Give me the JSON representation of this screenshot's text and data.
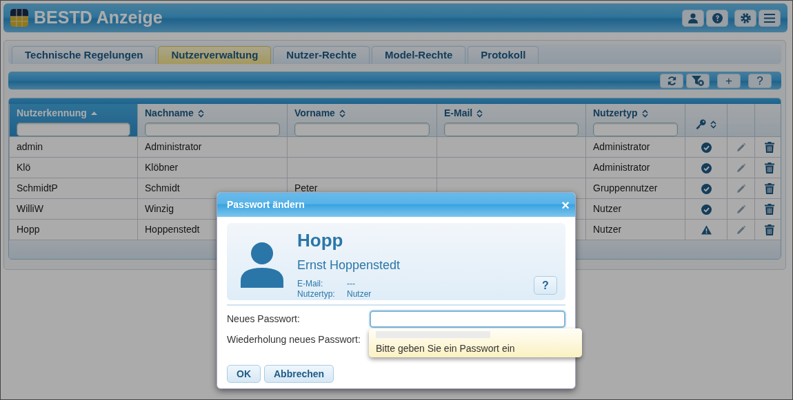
{
  "app": {
    "title": "BESTD Anzeige"
  },
  "tabs": [
    {
      "label": "Technische Regelungen",
      "selected": false
    },
    {
      "label": "Nutzerverwaltung",
      "selected": true
    },
    {
      "label": "Nutzer-Rechte",
      "selected": false
    },
    {
      "label": "Model-Rechte",
      "selected": false
    },
    {
      "label": "Protokoll",
      "selected": false
    }
  ],
  "toolbar": {
    "add_label": "+",
    "help_label": "?"
  },
  "table": {
    "columns": [
      {
        "kind": "text",
        "label": "Nutzerkennung",
        "sorted": true
      },
      {
        "kind": "text",
        "label": "Nachname",
        "sorted": false
      },
      {
        "kind": "text",
        "label": "Vorname",
        "sorted": false
      },
      {
        "kind": "text",
        "label": "E-Mail",
        "sorted": false
      },
      {
        "kind": "text",
        "label": "Nutzertyp",
        "sorted": false
      },
      {
        "kind": "key",
        "sorted": false
      }
    ],
    "rows": [
      {
        "login": "admin",
        "last_name": "Administrator",
        "type": "Administrator",
        "warning": false
      },
      {
        "login": "Klö",
        "last_name": "Klöbner",
        "type": "Administrator",
        "warning": false
      },
      {
        "login": "SchmidtP",
        "last_name": "Schmidt",
        "first_name": "Peter",
        "type": "Gruppennutzer",
        "warning": false
      },
      {
        "login": "WilliW",
        "last_name": "Winzig",
        "type": "Nutzer",
        "warning": false
      },
      {
        "login": "Hopp",
        "last_name": "Hoppenstedt",
        "type": "Nutzer",
        "warning": true
      }
    ]
  },
  "dialog": {
    "title": "Passwort ändern",
    "close_label": "×",
    "user": {
      "login": "Hopp",
      "full_name": "Ernst Hoppenstedt",
      "details": [
        {
          "label": "E-Mail:",
          "value": "---"
        },
        {
          "label": "Nutzertyp:",
          "value": "Nutzer"
        }
      ]
    },
    "help_label": "?",
    "fields": [
      {
        "label": "Neues Passwort:",
        "focused": true
      },
      {
        "label": "Wiederholung neues Passwort:"
      }
    ],
    "tooltip": "Bitte geben Sie ein Passwort ein",
    "buttons": [
      {
        "label": "OK"
      },
      {
        "label": "Abbrechen"
      }
    ]
  }
}
